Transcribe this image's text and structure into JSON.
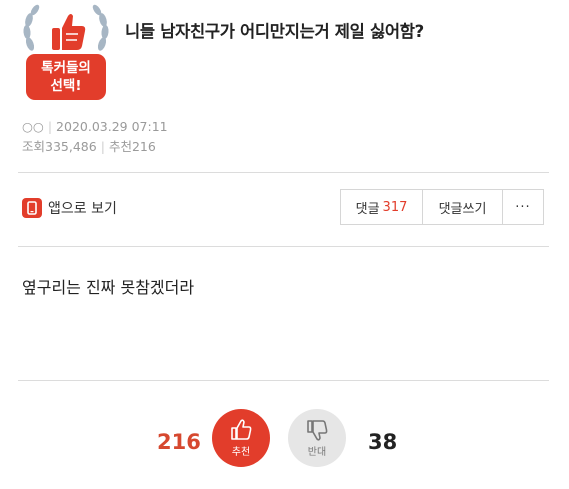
{
  "badge": {
    "line1": "톡커들의",
    "line2": "선택!"
  },
  "post": {
    "title": "니들 남자친구가 어디만지는거 제일 싫어함?",
    "author": "○○",
    "datetime": "2020.03.29 07:11",
    "views_label": "조회",
    "views": "335,486",
    "recommend_label": "추천",
    "recommends": "216",
    "body": "옆구리는 진짜 못참겠더라"
  },
  "toolbar": {
    "app_view_label": "앱으로 보기",
    "comments_label": "댓글",
    "comments_count": "317",
    "write_comment_label": "댓글쓰기",
    "more_label": "···"
  },
  "vote": {
    "up_count": "216",
    "up_label": "추천",
    "down_label": "반대",
    "down_count": "38"
  },
  "colors": {
    "accent": "#e23d2b",
    "muted": "#9a9a9a"
  }
}
